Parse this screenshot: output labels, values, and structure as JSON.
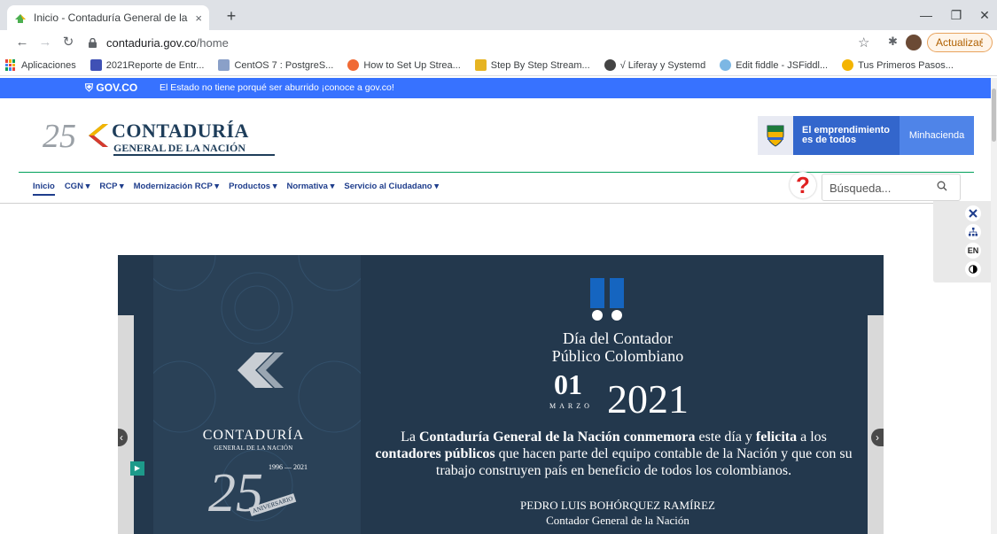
{
  "browser": {
    "tab_title": "Inicio - Contaduría General de la",
    "tab_close": "×",
    "new_tab": "+",
    "url_host": "contaduria.gov.co",
    "url_path": "/home",
    "update_label": "Actualizar",
    "update_dots": "⋮",
    "bookmarks": [
      {
        "label": "Aplicaciones",
        "color": "#e8453c"
      },
      {
        "label": "2021Reporte de Entr...",
        "color": "#3f51b5"
      },
      {
        "label": "CentOS 7 : PostgreS...",
        "color": "#8aa0c8"
      },
      {
        "label": "How to Set Up Strea...",
        "color": "#f06a35"
      },
      {
        "label": "Step By Step Stream...",
        "color": "#e6b422"
      },
      {
        "label": "√ Liferay y Systemd",
        "color": "#444444"
      },
      {
        "label": "Edit fiddle - JSFiddl...",
        "color": "#7cb7e4"
      },
      {
        "label": "Tus Primeros Pasos...",
        "color": "#f4b400"
      }
    ]
  },
  "govbar": {
    "logo": "GOV.CO",
    "text": "El Estado no tiene porqué ser aburrido ¡conoce a gov.co!"
  },
  "header": {
    "logo_number": "25",
    "logo_name": "CONTADURÍA",
    "logo_sub": "GENERAL DE LA NACIÓN",
    "emprendimiento": "El emprendimiento es de todos",
    "minhacienda": "Minhacienda"
  },
  "menu": {
    "items": [
      {
        "label": "Inicio"
      },
      {
        "label": "CGN ▾"
      },
      {
        "label": "RCP ▾"
      },
      {
        "label": "Modernización RCP ▾"
      },
      {
        "label": "Productos ▾"
      },
      {
        "label": "Normativa ▾"
      },
      {
        "label": "Servicio al Ciudadano ▾"
      }
    ]
  },
  "search": {
    "placeholder": "Búsqueda..."
  },
  "accessibility": {
    "lang": "EN"
  },
  "hero": {
    "brand": "CONTADURÍA",
    "brand_sub": "GENERAL DE LA NACIÓN",
    "years": "1996 — 2021",
    "logo_25": "25",
    "anniversary": "ANIVERSARIO",
    "title_line1": "Día del Contador",
    "title_line2": "Público Colombiano",
    "day": "01",
    "month": "MARZO",
    "year": "2021",
    "body_1": "La ",
    "body_2": "Contaduría General de la Nación conmemora",
    "body_3": " este día y ",
    "body_4": "felicita",
    "body_5": " a los ",
    "body_6": "contadores públicos",
    "body_7": " que hacen parte del equipo contable de la Nación y que con su trabajo construyen país en beneficio de todos los colombianos.",
    "signer_name": "PEDRO LUIS BOHÓRQUEZ RAMÍREZ",
    "signer_title": "Contador General de la Nación"
  }
}
